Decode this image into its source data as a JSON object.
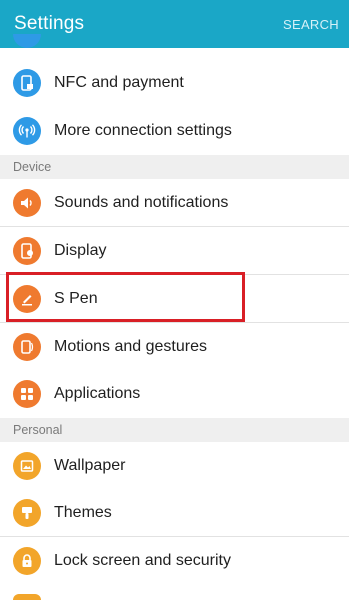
{
  "header": {
    "title": "Settings",
    "search_label": "SEARCH"
  },
  "sections": {
    "device": "Device",
    "personal": "Personal"
  },
  "items": {
    "nfc": {
      "label": "NFC and payment",
      "icon": "nfc-icon",
      "color": "#2e9ae6"
    },
    "more_connection": {
      "label": "More connection settings",
      "icon": "wireless-icon",
      "color": "#2e9ae6"
    },
    "sounds": {
      "label": "Sounds and notifications",
      "icon": "speaker-icon",
      "color": "#ef7a2f"
    },
    "display": {
      "label": "Display",
      "icon": "display-icon",
      "color": "#ef7a2f"
    },
    "spen": {
      "label": "S Pen",
      "icon": "pen-icon",
      "color": "#ef7a2f"
    },
    "motions": {
      "label": "Motions and gestures",
      "icon": "motion-icon",
      "color": "#ef7a2f"
    },
    "applications": {
      "label": "Applications",
      "icon": "apps-grid-icon",
      "color": "#ef7a2f"
    },
    "wallpaper": {
      "label": "Wallpaper",
      "icon": "wallpaper-icon",
      "color": "#f2a52a"
    },
    "themes": {
      "label": "Themes",
      "icon": "brush-icon",
      "color": "#f2a52a"
    },
    "lock_screen": {
      "label": "Lock screen and security",
      "icon": "lock-icon",
      "color": "#f2a52a"
    }
  },
  "colors": {
    "appbar": "#1aa7c7",
    "highlight_border": "#d91f26"
  }
}
